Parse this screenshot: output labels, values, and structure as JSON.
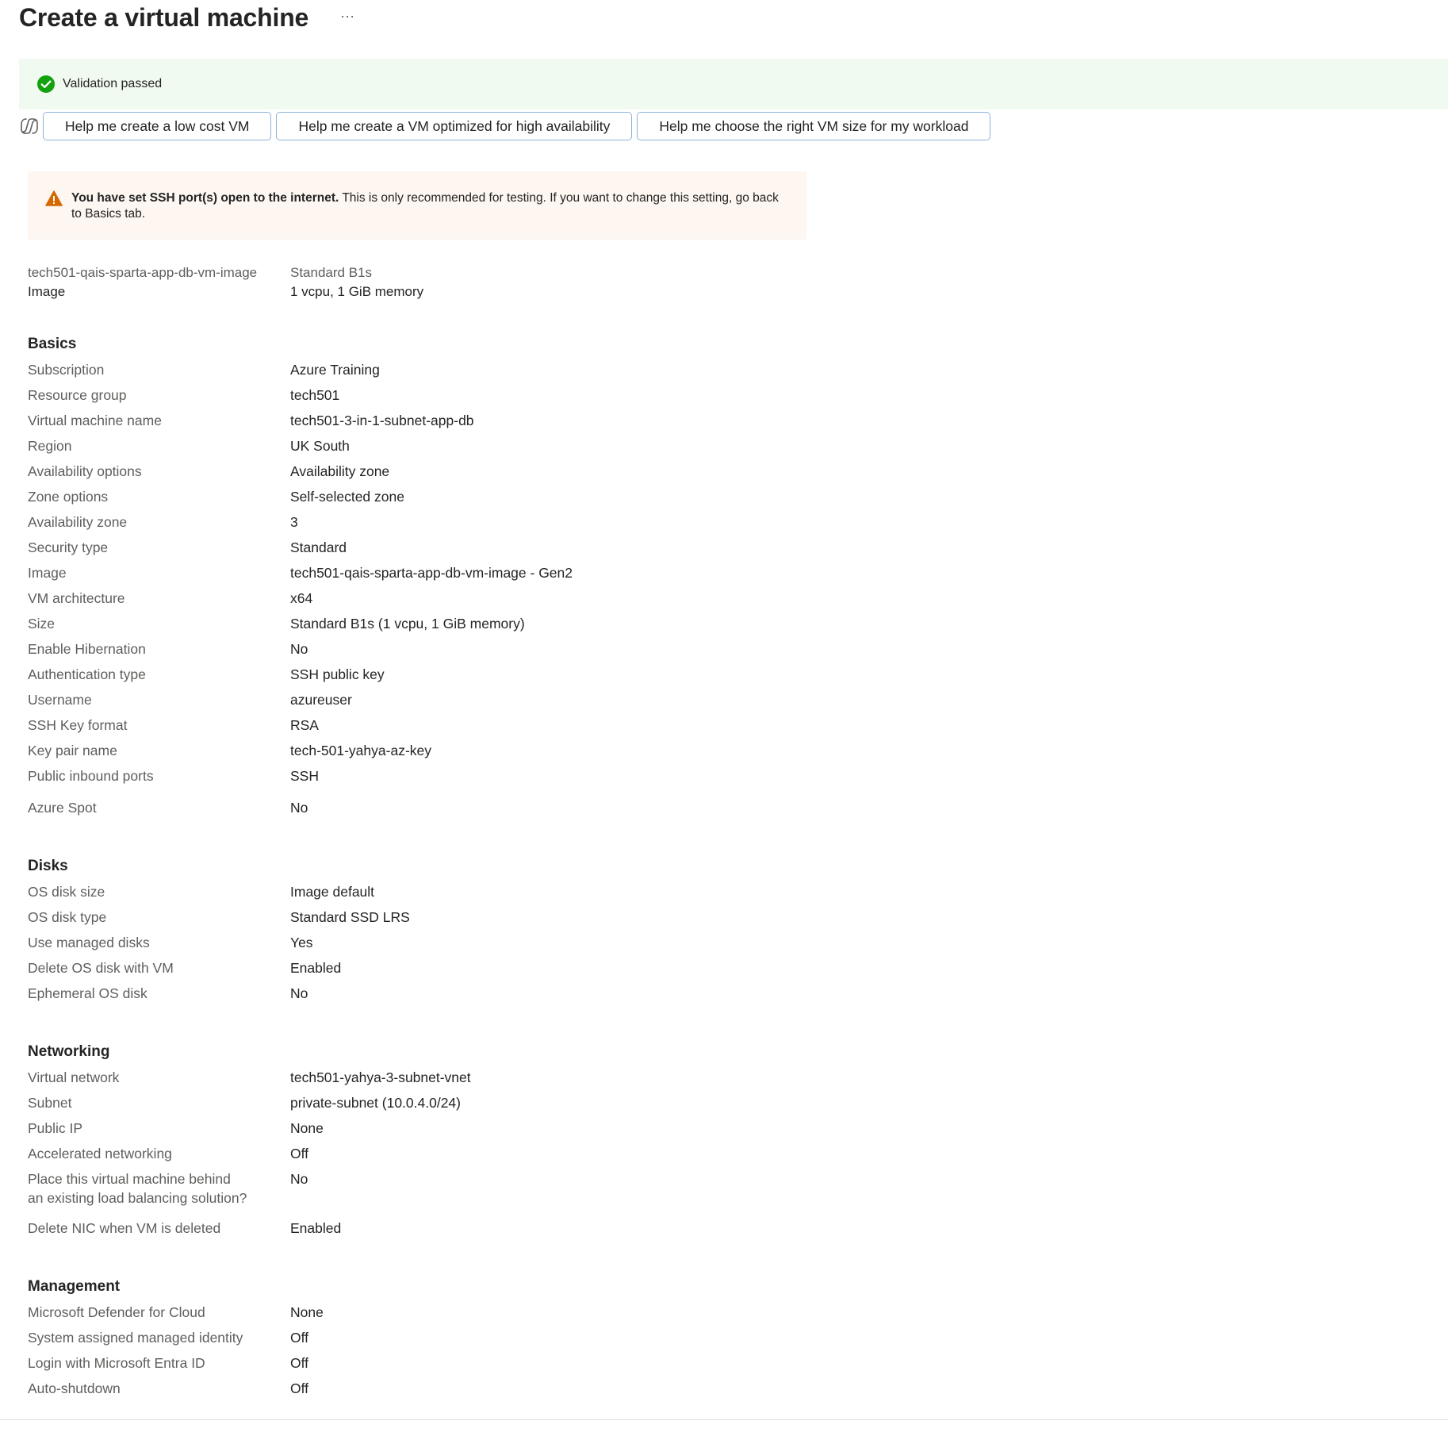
{
  "page": {
    "title": "Create a virtual machine",
    "more_label": "···"
  },
  "validation": {
    "text": "Validation passed",
    "color": "#13a10e"
  },
  "copilot": {
    "prompts": [
      "Help me create a low cost VM",
      "Help me create a VM optimized for high availability",
      "Help me choose the right VM size for my workload"
    ]
  },
  "warning": {
    "bold": "You have set SSH port(s) open to the internet.",
    "text": " This is only recommended for testing.  If you want to change this setting, go back to Basics tab.",
    "color": "#d56900"
  },
  "summary": {
    "image_name": "tech501-qais-sparta-app-db-vm-image",
    "image_label": "Image",
    "size_name": "Standard B1s",
    "size_detail": "1 vcpu, 1 GiB memory"
  },
  "sections": {
    "basics": {
      "title": "Basics",
      "rows": [
        {
          "label": "Subscription",
          "value": "Azure Training"
        },
        {
          "label": "Resource group",
          "value": "tech501"
        },
        {
          "label": "Virtual machine name",
          "value": "tech501-3-in-1-subnet-app-db"
        },
        {
          "label": "Region",
          "value": "UK South"
        },
        {
          "label": "Availability options",
          "value": "Availability zone"
        },
        {
          "label": "Zone options",
          "value": "Self-selected zone"
        },
        {
          "label": "Availability zone",
          "value": "3"
        },
        {
          "label": "Security type",
          "value": "Standard"
        },
        {
          "label": "Image",
          "value": "tech501-qais-sparta-app-db-vm-image - Gen2"
        },
        {
          "label": "VM architecture",
          "value": "x64"
        },
        {
          "label": "Size",
          "value": "Standard B1s (1 vcpu, 1 GiB memory)"
        },
        {
          "label": "Enable Hibernation",
          "value": "No"
        },
        {
          "label": "Authentication type",
          "value": "SSH public key"
        },
        {
          "label": "Username",
          "value": "azureuser"
        },
        {
          "label": "SSH Key format",
          "value": "RSA"
        },
        {
          "label": "Key pair name",
          "value": "tech-501-yahya-az-key"
        },
        {
          "label": "Public inbound ports",
          "value": "SSH"
        },
        {
          "label": "Azure Spot",
          "value": "No"
        }
      ]
    },
    "disks": {
      "title": "Disks",
      "rows": [
        {
          "label": "OS disk size",
          "value": "Image default"
        },
        {
          "label": "OS disk type",
          "value": "Standard SSD LRS"
        },
        {
          "label": "Use managed disks",
          "value": "Yes"
        },
        {
          "label": "Delete OS disk with VM",
          "value": "Enabled"
        },
        {
          "label": "Ephemeral OS disk",
          "value": "No"
        }
      ]
    },
    "networking": {
      "title": "Networking",
      "rows": [
        {
          "label": "Virtual network",
          "value": "tech501-yahya-3-subnet-vnet"
        },
        {
          "label": "Subnet",
          "value": "private-subnet (10.0.4.0/24)"
        },
        {
          "label": "Public IP",
          "value": "None"
        },
        {
          "label": "Accelerated networking",
          "value": "Off"
        },
        {
          "label": "Place this virtual machine behind an existing load balancing solution?",
          "value": "No"
        },
        {
          "label": "Delete NIC when VM is deleted",
          "value": "Enabled"
        }
      ]
    },
    "management": {
      "title": "Management",
      "rows": [
        {
          "label": "Microsoft Defender for Cloud",
          "value": "None"
        },
        {
          "label": "System assigned managed identity",
          "value": "Off"
        },
        {
          "label": "Login with Microsoft Entra ID",
          "value": "Off"
        },
        {
          "label": "Auto-shutdown",
          "value": "Off"
        }
      ]
    }
  }
}
